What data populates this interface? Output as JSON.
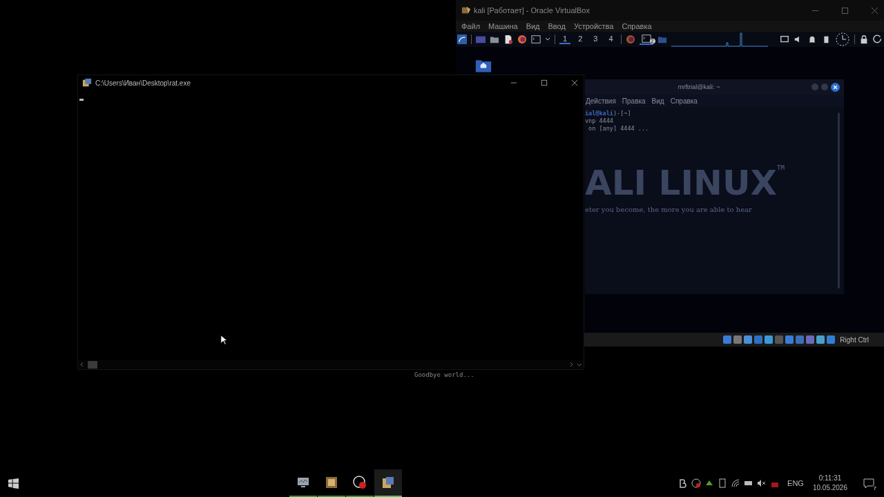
{
  "console_window": {
    "title": "C:\\Users\\Иван\\Desktop\\rat.exe"
  },
  "background_output": "Goodbye world...",
  "virtualbox": {
    "title": "kali [Работает] - Oracle VirtualBox",
    "menu": [
      "Файл",
      "Машина",
      "Вид",
      "Ввод",
      "Устройства",
      "Справка"
    ],
    "panel": {
      "workspaces": [
        {
          "label": "1",
          "selected": true
        },
        {
          "label": "2",
          "selected": false
        },
        {
          "label": "3",
          "selected": false
        },
        {
          "label": "4",
          "selected": false
        }
      ],
      "terminal_badge": "2"
    },
    "terminal": {
      "title": "mrftrial@kali: ~",
      "menu": [
        "Действия",
        "Правка",
        "Вид",
        "Справка"
      ],
      "lines": [
        [
          {
            "text": "ial@kali",
            "kind": "host"
          },
          {
            "text": ")-[~]",
            "kind": "plain"
          }
        ],
        [
          {
            "text": "vnp 4444",
            "kind": "plain"
          }
        ],
        [
          {
            "text": " on [any] 4444 ...",
            "kind": "plain"
          }
        ]
      ],
      "wallpaper_title": "ALI LINUX",
      "wallpaper_mark": "TM",
      "wallpaper_motto": "eter you become, the more you are able to hear"
    },
    "status_bar": {
      "host_key": "Right Ctrl"
    }
  },
  "taskbar": {
    "apps": [
      {
        "kind": "monitor",
        "selected": false
      },
      {
        "kind": "chip",
        "selected": false
      },
      {
        "kind": "recorder",
        "selected": false
      },
      {
        "kind": "console",
        "selected": true
      }
    ],
    "language": "ENG",
    "time": "0:11:31",
    "date": "10.05.2026",
    "notifications": "7"
  }
}
